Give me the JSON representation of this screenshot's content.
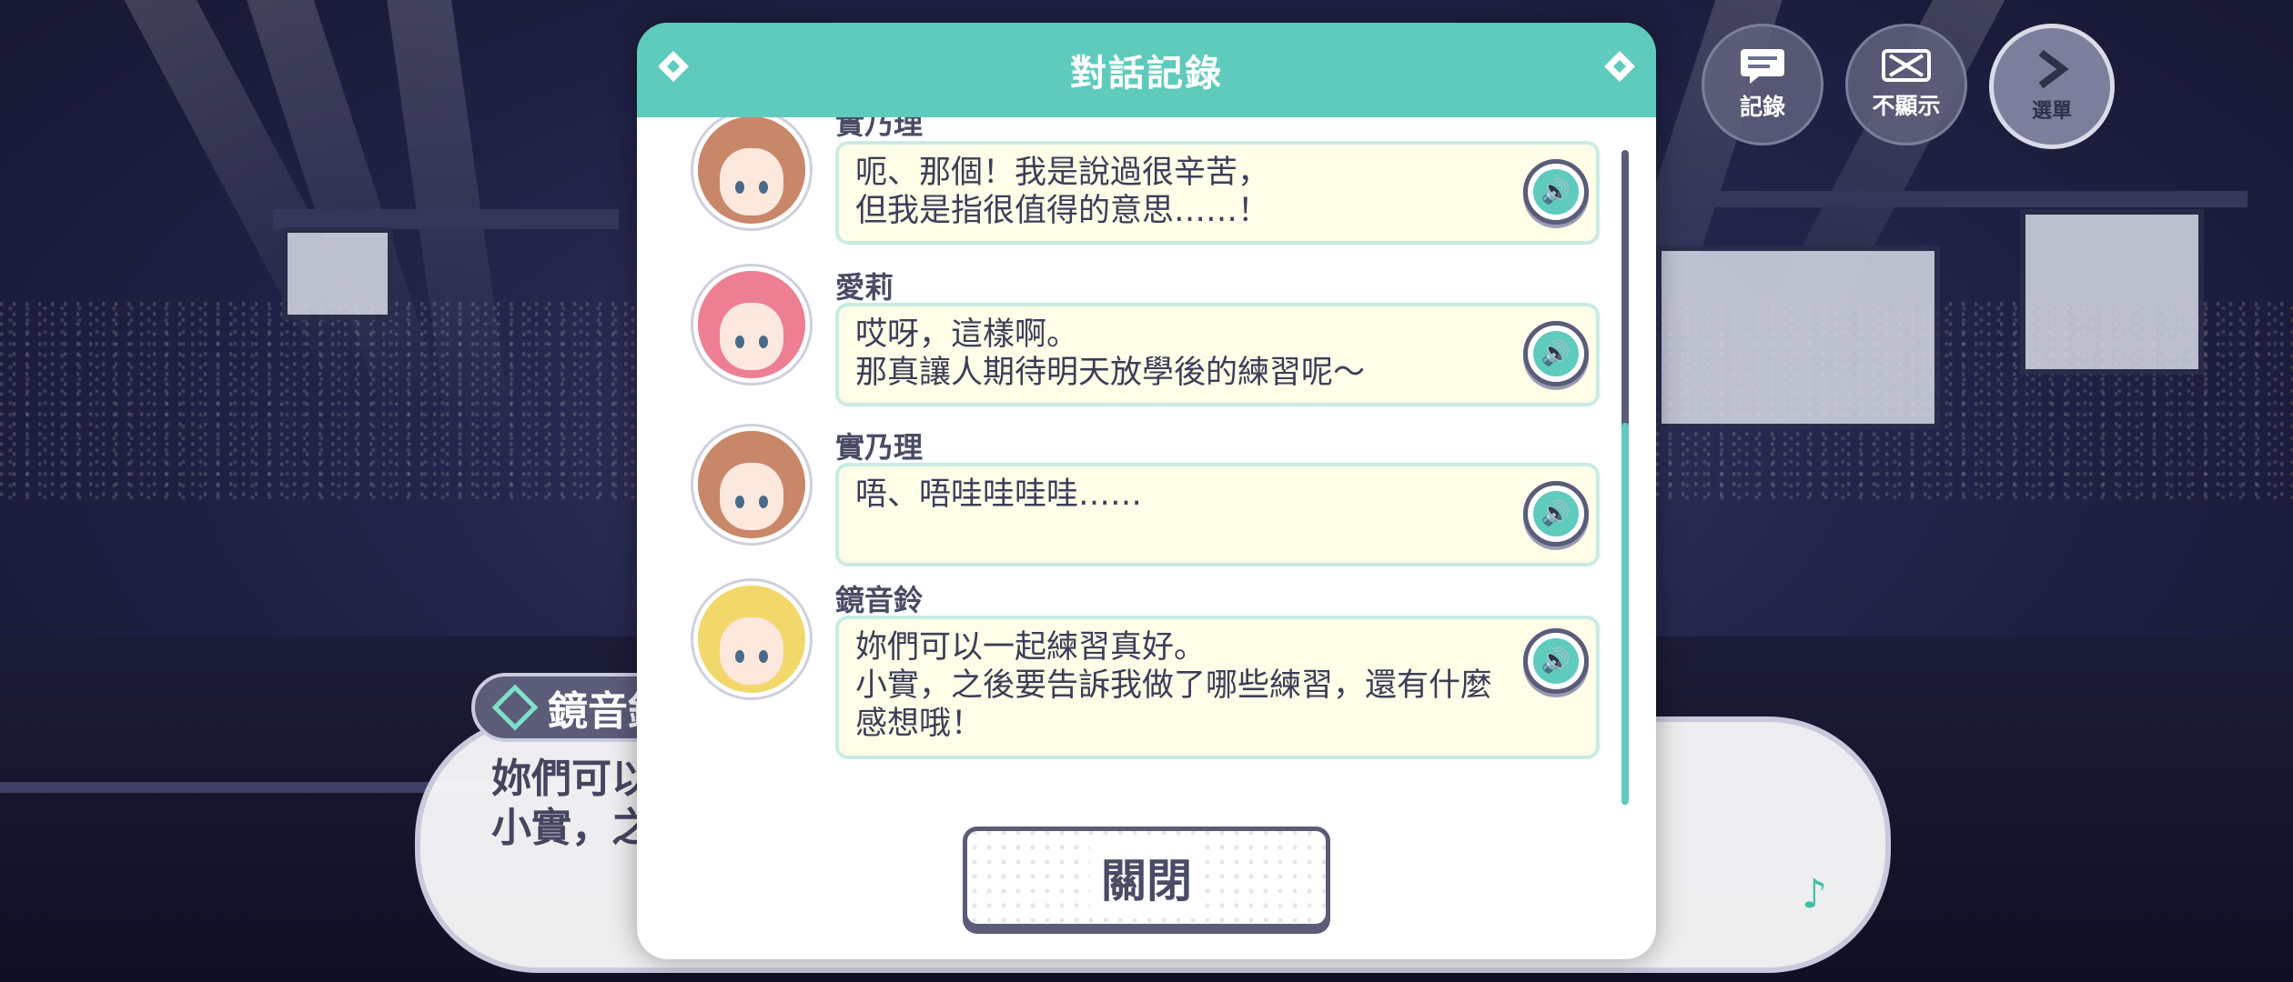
{
  "top_buttons": [
    {
      "label": "記錄",
      "icon": "log-icon"
    },
    {
      "label": "不顯示",
      "icon": "hide-icon"
    },
    {
      "label": "選單",
      "icon": "menu-chevron-icon"
    }
  ],
  "dialogue": {
    "speaker": "鏡音鈴",
    "text_line1": "妳們可以",
    "text_line2": "小實，之"
  },
  "backlog": {
    "title": "對話記錄",
    "entries": [
      {
        "speaker": "實乃理",
        "text": "呃、那個！我是說過很辛苦，\n但我是指很值得的意思……！",
        "hair": "#c9876a",
        "accent": "#f0a040"
      },
      {
        "speaker": "愛莉",
        "text": "哎呀，這樣啊。\n那真讓人期待明天放學後的練習呢～",
        "hair": "#ee7f93",
        "accent": "#7a3a6a"
      },
      {
        "speaker": "實乃理",
        "text": "唔、唔哇哇哇哇……",
        "hair": "#c9876a",
        "accent": "#f0a040"
      },
      {
        "speaker": "鏡音鈴",
        "text": "妳們可以一起練習真好。\n小實，之後要告訴我做了哪些練習，還有什麼\n感想哦！",
        "hair": "#f2d76a",
        "accent": "#ffffff"
      }
    ],
    "close_label": "關閉"
  },
  "colors": {
    "teal": "#5ecbbc",
    "navy": "#5a5c78",
    "bubble": "#fefde8"
  }
}
